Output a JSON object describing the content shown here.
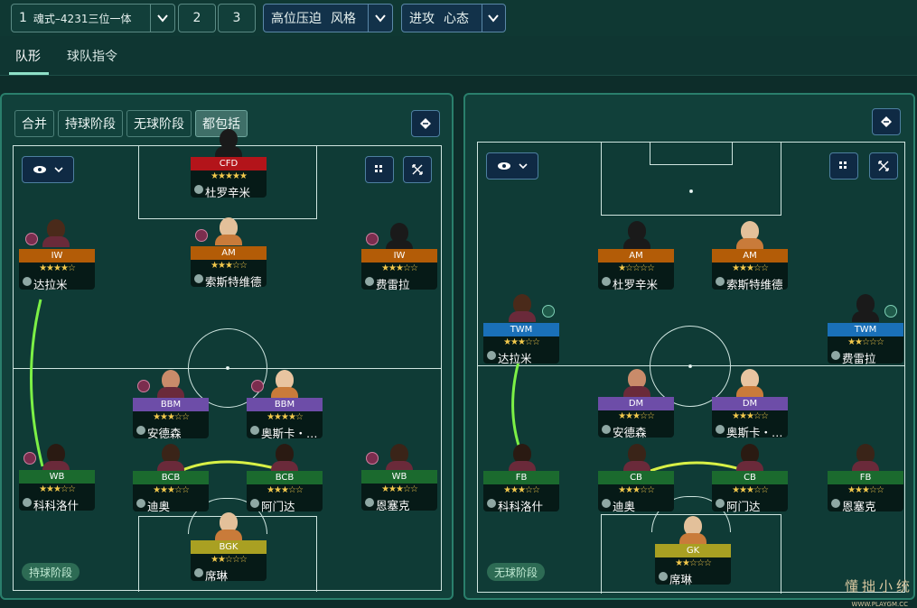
{
  "topbar": {
    "formation": {
      "number": "1",
      "label": "魂式–4231三位一体"
    },
    "tactic_tabs": [
      "2",
      "3"
    ],
    "mentality_left": {
      "a": "高位压迫",
      "b": "风格"
    },
    "mentality_right": {
      "a": "进攻",
      "b": "心态"
    }
  },
  "tabs": [
    {
      "label": "队形"
    },
    {
      "label": "球队指令"
    }
  ],
  "filters": [
    "合并",
    "持球阶段",
    "无球阶段",
    "都包括"
  ],
  "left_phase": "持球阶段",
  "right_phase": "无球阶段",
  "colors": {
    "st": "#b3141a",
    "am": "#b35c07",
    "bbm": "#6d4da8",
    "dm": "#6d4da8",
    "wb": "#1b6a2e",
    "bcb": "#1b6a2e",
    "gk": "#a9a022",
    "twm": "#1a70b8",
    "star": "#f2c84b",
    "run_line": "#7cf046"
  },
  "left_players": [
    {
      "role": "CFD",
      "stars": "★★★★★",
      "name": "杜罗辛米"
    },
    {
      "role": "IW",
      "stars": "★★★★☆",
      "name": "达拉米"
    },
    {
      "role": "AM",
      "stars": "★★★☆☆",
      "name": "索斯特维德"
    },
    {
      "role": "IW",
      "stars": "★★★☆☆",
      "name": "费雷拉"
    },
    {
      "role": "BBM",
      "stars": "★★★☆☆",
      "name": "安德森"
    },
    {
      "role": "BBM",
      "stars": "★★★★☆",
      "name": "奥斯卡・…"
    },
    {
      "role": "WB",
      "stars": "★★★☆☆",
      "name": "科科洛什"
    },
    {
      "role": "BCB",
      "stars": "★★★☆☆",
      "name": "迪奥"
    },
    {
      "role": "BCB",
      "stars": "★★★☆☆",
      "name": "阿门达"
    },
    {
      "role": "WB",
      "stars": "★★★☆☆",
      "name": "恩塞克"
    },
    {
      "role": "BGK",
      "stars": "★★☆☆☆",
      "name": "席琳"
    }
  ],
  "right_players": [
    {
      "role": "AM",
      "stars": "★☆☆☆☆",
      "name": "杜罗辛米"
    },
    {
      "role": "AM",
      "stars": "★★★☆☆",
      "name": "索斯特维德"
    },
    {
      "role": "TWM",
      "stars": "★★★☆☆",
      "name": "达拉米"
    },
    {
      "role": "TWM",
      "stars": "★★☆☆☆",
      "name": "费雷拉"
    },
    {
      "role": "DM",
      "stars": "★★★☆☆",
      "name": "安德森"
    },
    {
      "role": "DM",
      "stars": "★★★☆☆",
      "name": "奥斯卡・…"
    },
    {
      "role": "FB",
      "stars": "★★★☆☆",
      "name": "科科洛什"
    },
    {
      "role": "CB",
      "stars": "★★★☆☆",
      "name": "迪奥"
    },
    {
      "role": "CB",
      "stars": "★★★☆☆",
      "name": "阿门达"
    },
    {
      "role": "FB",
      "stars": "★★★☆☆",
      "name": "恩塞克"
    },
    {
      "role": "GK",
      "stars": "★★☆☆☆",
      "name": "席琳"
    }
  ],
  "watermark": {
    "text": "懂拙小统",
    "url": "WWW.PLAYGM.CC"
  }
}
